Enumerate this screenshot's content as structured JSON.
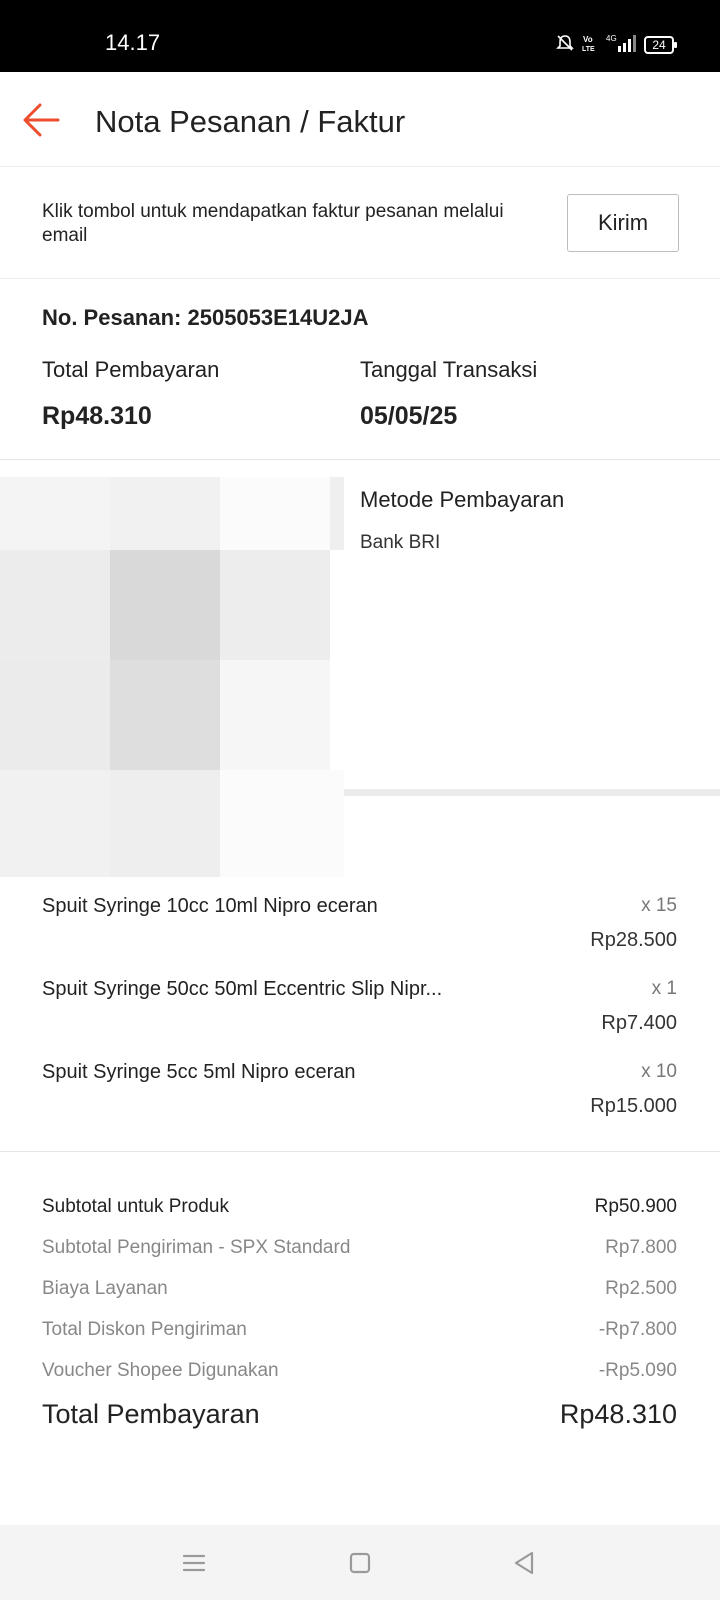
{
  "status_bar": {
    "time": "14.17",
    "battery": "24",
    "icons": [
      "mute-bell-icon",
      "volte-icon",
      "signal-4g-icon",
      "battery-icon"
    ]
  },
  "header": {
    "title": "Nota Pesanan / Faktur",
    "back_icon": "arrow-left-icon"
  },
  "email_banner": {
    "text": "Klik tombol untuk mendapatkan faktur pesanan melalui email",
    "button_label": "Kirim"
  },
  "order": {
    "order_number": "No. Pesanan: 2505053E14U2JA",
    "total_label": "Total Pembayaran",
    "total_value": "Rp48.310",
    "date_label": "Tanggal Transaksi",
    "date_value": "05/05/25"
  },
  "payment": {
    "label": "Metode Pembayaran",
    "value": "Bank BRI"
  },
  "products": [
    {
      "name": "Spuit Syringe 10cc 10ml Nipro eceran",
      "qty": "x 15",
      "price": "Rp28.500"
    },
    {
      "name": "Spuit Syringe 50cc 50ml Eccentric Slip Nipr...",
      "qty": "x 1",
      "price": "Rp7.400"
    },
    {
      "name": "Spuit Syringe 5cc 5ml Nipro eceran",
      "qty": "x 10",
      "price": "Rp15.000"
    }
  ],
  "summary": [
    {
      "label": "Subtotal untuk Produk",
      "value": "Rp50.900"
    },
    {
      "label": "Subtotal Pengiriman - SPX Standard",
      "value": "Rp7.800"
    },
    {
      "label": "Biaya Layanan",
      "value": "Rp2.500"
    },
    {
      "label": "Total Diskon Pengiriman",
      "value": "-Rp7.800"
    },
    {
      "label": "Voucher Shopee Digunakan",
      "value": "-Rp5.090"
    }
  ],
  "grand_total": {
    "label": "Total Pembayaran",
    "value": "Rp48.310"
  },
  "nav": {
    "icons": [
      "menu-icon",
      "home-square-icon",
      "back-triangle-icon"
    ]
  },
  "colors": {
    "accent": "#ee4d2d",
    "muted_text": "#888888",
    "divider": "#ebebeb"
  }
}
